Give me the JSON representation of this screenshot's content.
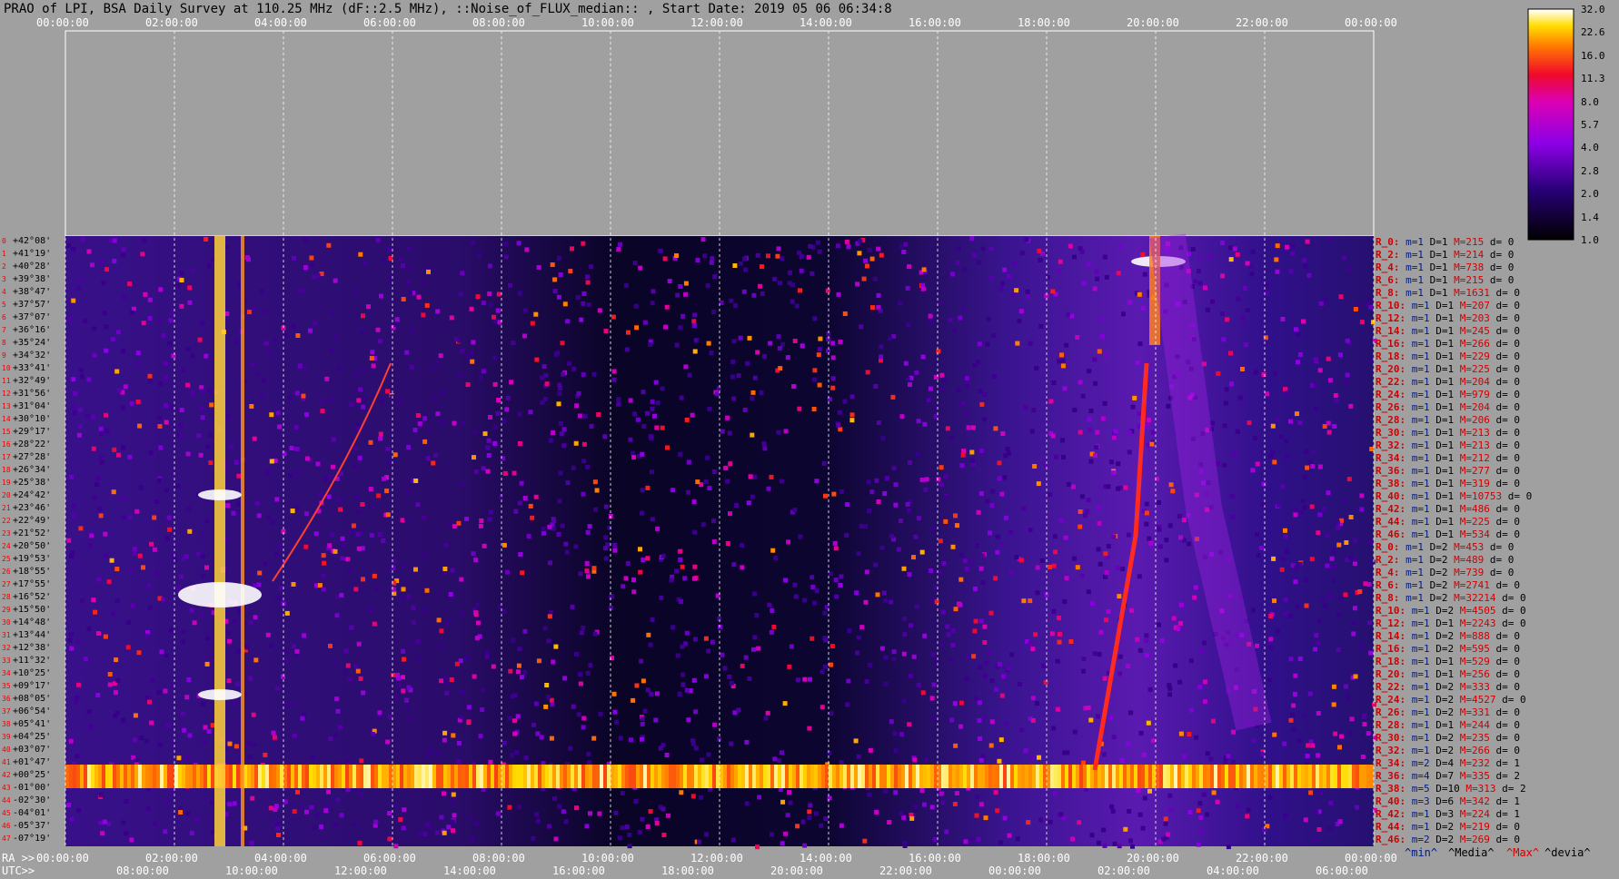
{
  "title": "PRAO of LPI, BSA Daily Survey at 110.25 MHz (dF::2.5 MHz), ::Noise_of_FLUX_median:: , Start Date: 2019 05 06 06:34:8",
  "top_ticks": [
    "00:00:00",
    "02:00:00",
    "04:00:00",
    "06:00:00",
    "08:00:00",
    "10:00:00",
    "12:00:00",
    "14:00:00",
    "16:00:00",
    "18:00:00",
    "20:00:00",
    "22:00:00",
    "00:00:00"
  ],
  "ra_label": "RA >>",
  "ra_ticks": [
    "00:00:00",
    "02:00:00",
    "04:00:00",
    "06:00:00",
    "08:00:00",
    "10:00:00",
    "12:00:00",
    "14:00:00",
    "16:00:00",
    "18:00:00",
    "20:00:00",
    "22:00:00",
    "00:00:00"
  ],
  "utc_label": "UTC>>",
  "utc_ticks": [
    "08:00:00",
    "10:00:00",
    "12:00:00",
    "14:00:00",
    "16:00:00",
    "18:00:00",
    "20:00:00",
    "22:00:00",
    "00:00:00",
    "02:00:00",
    "04:00:00",
    "06:00:00"
  ],
  "declinations": [
    "+42°08'",
    "+41°19'",
    "+40°28'",
    "+39°38'",
    "+38°47'",
    "+37°57'",
    "+37°07'",
    "+36°16'",
    "+35°24'",
    "+34°32'",
    "+33°41'",
    "+32°49'",
    "+31°56'",
    "+31°04'",
    "+30°10'",
    "+29°17'",
    "+28°22'",
    "+27°28'",
    "+26°34'",
    "+25°38'",
    "+24°42'",
    "+23°46'",
    "+22°49'",
    "+21°52'",
    "+20°50'",
    "+19°53'",
    "+18°55'",
    "+17°55'",
    "+16°52'",
    "+15°50'",
    "+14°48'",
    "+13°44'",
    "+12°38'",
    "+11°32'",
    "+10°25'",
    "+09°17'",
    "+08°05'",
    "+06°54'",
    "+05°41'",
    "+04°25'",
    "+03°07'",
    "+01°47'",
    "+00°25'",
    "-01°00'",
    "-02°30'",
    "-04°01'",
    "-05°37'",
    "-07°19'"
  ],
  "colorbar": {
    "ticks": [
      "32.0",
      "22.6",
      "16.0",
      "11.3",
      "8.0",
      "5.7",
      "4.0",
      "2.8",
      "2.0",
      "1.4",
      "1.0"
    ]
  },
  "rows": [
    {
      "r": "R_0:",
      "m": "m=1",
      "d": "D=1",
      "h": "M=215",
      "v": "d= 0"
    },
    {
      "r": "R_2:",
      "m": "m=1",
      "d": "D=1",
      "h": "M=214",
      "v": "d= 0"
    },
    {
      "r": "R_4:",
      "m": "m=1",
      "d": "D=1",
      "h": "M=738",
      "v": "d= 0"
    },
    {
      "r": "R_6:",
      "m": "m=1",
      "d": "D=1",
      "h": "M=215",
      "v": "d= 0"
    },
    {
      "r": "R_8:",
      "m": "m=1",
      "d": "D=1",
      "h": "M=1631",
      "v": "d= 0"
    },
    {
      "r": "R_10:",
      "m": "m=1",
      "d": "D=1",
      "h": "M=207",
      "v": "d= 0"
    },
    {
      "r": "R_12:",
      "m": "m=1",
      "d": "D=1",
      "h": "M=203",
      "v": "d= 0"
    },
    {
      "r": "R_14:",
      "m": "m=1",
      "d": "D=1",
      "h": "M=245",
      "v": "d= 0"
    },
    {
      "r": "R_16:",
      "m": "m=1",
      "d": "D=1",
      "h": "M=266",
      "v": "d= 0"
    },
    {
      "r": "R_18:",
      "m": "m=1",
      "d": "D=1",
      "h": "M=229",
      "v": "d= 0"
    },
    {
      "r": "R_20:",
      "m": "m=1",
      "d": "D=1",
      "h": "M=225",
      "v": "d= 0"
    },
    {
      "r": "R_22:",
      "m": "m=1",
      "d": "D=1",
      "h": "M=204",
      "v": "d= 0"
    },
    {
      "r": "R_24:",
      "m": "m=1",
      "d": "D=1",
      "h": "M=979",
      "v": "d= 0"
    },
    {
      "r": "R_26:",
      "m": "m=1",
      "d": "D=1",
      "h": "M=204",
      "v": "d= 0"
    },
    {
      "r": "R_28:",
      "m": "m=1",
      "d": "D=1",
      "h": "M=206",
      "v": "d= 0"
    },
    {
      "r": "R_30:",
      "m": "m=1",
      "d": "D=1",
      "h": "M=213",
      "v": "d= 0"
    },
    {
      "r": "R_32:",
      "m": "m=1",
      "d": "D=1",
      "h": "M=213",
      "v": "d= 0"
    },
    {
      "r": "R_34:",
      "m": "m=1",
      "d": "D=1",
      "h": "M=212",
      "v": "d= 0"
    },
    {
      "r": "R_36:",
      "m": "m=1",
      "d": "D=1",
      "h": "M=277",
      "v": "d= 0"
    },
    {
      "r": "R_38:",
      "m": "m=1",
      "d": "D=1",
      "h": "M=319",
      "v": "d= 0"
    },
    {
      "r": "R_40:",
      "m": "m=1",
      "d": "D=1",
      "h": "M=10753",
      "v": "d= 0"
    },
    {
      "r": "R_42:",
      "m": "m=1",
      "d": "D=1",
      "h": "M=486",
      "v": "d= 0"
    },
    {
      "r": "R_44:",
      "m": "m=1",
      "d": "D=1",
      "h": "M=225",
      "v": "d= 0"
    },
    {
      "r": "R_46:",
      "m": "m=1",
      "d": "D=1",
      "h": "M=534",
      "v": "d= 0"
    },
    {
      "r": "R_0:",
      "m": "m=1",
      "d": "D=2",
      "h": "M=453",
      "v": "d= 0"
    },
    {
      "r": "R_2:",
      "m": "m=1",
      "d": "D=2",
      "h": "M=489",
      "v": "d= 0"
    },
    {
      "r": "R_4:",
      "m": "m=1",
      "d": "D=2",
      "h": "M=739",
      "v": "d= 0"
    },
    {
      "r": "R_6:",
      "m": "m=1",
      "d": "D=2",
      "h": "M=2741",
      "v": "d= 0"
    },
    {
      "r": "R_8:",
      "m": "m=1",
      "d": "D=2",
      "h": "M=32214",
      "v": "d= 0"
    },
    {
      "r": "R_10:",
      "m": "m=1",
      "d": "D=2",
      "h": "M=4505",
      "v": "d= 0"
    },
    {
      "r": "R_12:",
      "m": "m=1",
      "d": "D=1",
      "h": "M=2243",
      "v": "d= 0"
    },
    {
      "r": "R_14:",
      "m": "m=1",
      "d": "D=2",
      "h": "M=888",
      "v": "d= 0"
    },
    {
      "r": "R_16:",
      "m": "m=1",
      "d": "D=2",
      "h": "M=595",
      "v": "d= 0"
    },
    {
      "r": "R_18:",
      "m": "m=1",
      "d": "D=1",
      "h": "M=529",
      "v": "d= 0"
    },
    {
      "r": "R_20:",
      "m": "m=1",
      "d": "D=1",
      "h": "M=256",
      "v": "d= 0"
    },
    {
      "r": "R_22:",
      "m": "m=1",
      "d": "D=2",
      "h": "M=333",
      "v": "d= 0"
    },
    {
      "r": "R_24:",
      "m": "m=1",
      "d": "D=2",
      "h": "M=4527",
      "v": "d= 0"
    },
    {
      "r": "R_26:",
      "m": "m=1",
      "d": "D=2",
      "h": "M=331",
      "v": "d= 0"
    },
    {
      "r": "R_28:",
      "m": "m=1",
      "d": "D=1",
      "h": "M=244",
      "v": "d= 0"
    },
    {
      "r": "R_30:",
      "m": "m=1",
      "d": "D=2",
      "h": "M=235",
      "v": "d= 0"
    },
    {
      "r": "R_32:",
      "m": "m=1",
      "d": "D=2",
      "h": "M=266",
      "v": "d= 0"
    },
    {
      "r": "R_34:",
      "m": "m=2",
      "d": "D=4",
      "h": "M=232",
      "v": "d= 1"
    },
    {
      "r": "R_36:",
      "m": "m=4",
      "d": "D=7",
      "h": "M=335",
      "v": "d= 2"
    },
    {
      "r": "R_38:",
      "m": "m=5",
      "d": "D=10",
      "h": "M=313",
      "v": "d= 2"
    },
    {
      "r": "R_40:",
      "m": "m=3",
      "d": "D=6",
      "h": "M=342",
      "v": "d= 1"
    },
    {
      "r": "R_42:",
      "m": "m=1",
      "d": "D=3",
      "h": "M=224",
      "v": "d= 1"
    },
    {
      "r": "R_44:",
      "m": "m=1",
      "d": "D=2",
      "h": "M=219",
      "v": "d= 0"
    },
    {
      "r": "R_46:",
      "m": "m=2",
      "d": "D=2",
      "h": "M=269",
      "v": "d= 0"
    }
  ],
  "legend": {
    "min": "^min^",
    "median": "^Media^",
    "max": "^Max^",
    "devia": "^devia^"
  },
  "colors": {
    "min": "#001a80",
    "median": "#000000",
    "max": "#d00000",
    "devia": "#000000"
  },
  "chart_data": {
    "type": "heatmap",
    "title": "PRAO of LPI, BSA Daily Survey at 110.25 MHz (dF::2.5 MHz), ::Noise_of_FLUX_median:: , Start Date: 2019 05 06 06:34:8",
    "x_axis_ra": [
      "00:00:00",
      "02:00:00",
      "04:00:00",
      "06:00:00",
      "08:00:00",
      "10:00:00",
      "12:00:00",
      "14:00:00",
      "16:00:00",
      "18:00:00",
      "20:00:00",
      "22:00:00",
      "00:00:00"
    ],
    "x_axis_utc": [
      "08:00:00",
      "10:00:00",
      "12:00:00",
      "14:00:00",
      "16:00:00",
      "18:00:00",
      "20:00:00",
      "22:00:00",
      "00:00:00",
      "02:00:00",
      "04:00:00",
      "06:00:00"
    ],
    "beams": 48,
    "color_scale": {
      "min": 1.0,
      "max": 32.0,
      "scale": "log2",
      "ticks": [
        32.0,
        22.6,
        16.0,
        11.3,
        8.0,
        5.7,
        4.0,
        2.8,
        2.0,
        1.4,
        1.0
      ]
    },
    "grid": true
  }
}
